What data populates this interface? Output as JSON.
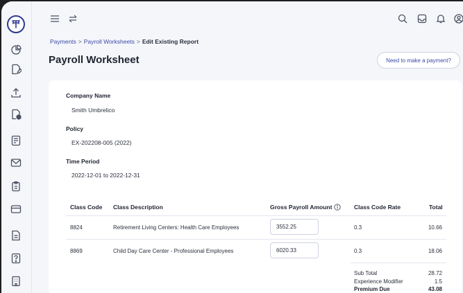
{
  "topbar": {
    "icons": [
      "menu-icon",
      "swap-icon",
      "search-icon",
      "inbox-icon",
      "bell-icon",
      "user-icon"
    ]
  },
  "sidebar": {
    "items": [
      "pie-chart-icon",
      "document-edit-icon",
      "upload-icon",
      "document-check-icon",
      "list-document-icon",
      "mail-icon",
      "clipboard-icon",
      "credit-card-icon",
      "file-icon",
      "help-icon",
      "building-icon"
    ]
  },
  "breadcrumb": {
    "items": [
      "Payments",
      "Payroll Worksheets",
      "Edit Existing Report"
    ],
    "separator": ">"
  },
  "page": {
    "title": "Payroll Worksheet",
    "pay_button": "Need to make a payment?"
  },
  "details": {
    "company_label": "Company Name",
    "company_value": "Smith Umbrelico",
    "policy_label": "Policy",
    "policy_value": "EX-202208-005 (2022)",
    "period_label": "Time Period",
    "period_value": "2022-12-01 to 2022-12-31"
  },
  "table": {
    "headers": [
      "Class Code",
      "Class Description",
      "Gross Payroll Amount",
      "Class Code Rate",
      "Total"
    ],
    "rows": [
      {
        "code": "8824",
        "description": "Retirement Living Centers: Health Care Employees",
        "payroll": "3552.25",
        "rate": "0.3",
        "total": "10.66"
      },
      {
        "code": "8869",
        "description": "Child Day Care Center - Professional Employees",
        "payroll": "6020.33",
        "rate": "0.3",
        "total": "18.06"
      }
    ]
  },
  "summary": {
    "subtotal_label": "Sub Total",
    "subtotal_value": "28.72",
    "modifier_label": "Experience Modifier",
    "modifier_value": "1.5",
    "premium_label": "Premium Due",
    "premium_value": "43.08"
  },
  "colors": {
    "accent": "#3d4aa8",
    "background": "#f4f6fa",
    "card": "#ffffff"
  }
}
